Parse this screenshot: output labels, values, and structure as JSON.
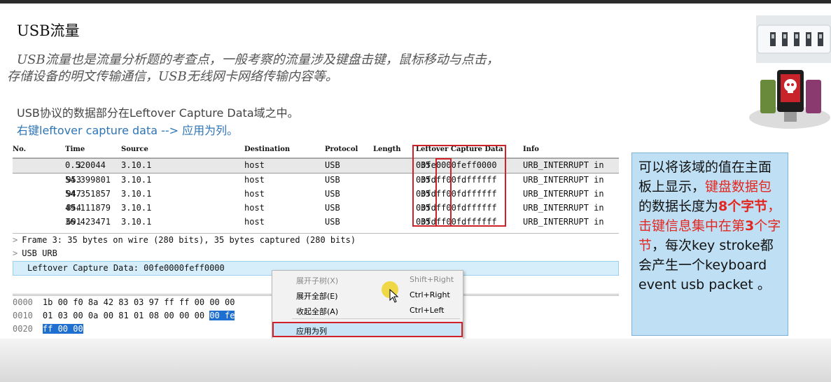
{
  "slide": {
    "title": "USB流量",
    "intro_line1": "USB流量也是流量分析题的考查点，一般考察的流量涉及键盘击键，鼠标移动与点击，",
    "intro_line2": "存储设备的明文传输通信，USB无线网卡网络传输内容等。",
    "note1": "USB协议的数据部分在Leftover Capture Data域之中。",
    "note2": "右键leftover capture data --> 应用为列。"
  },
  "packet_list": {
    "columns": [
      "No.",
      "Time",
      "Source",
      "Destination",
      "Protocol",
      "Length",
      "Leftover Capture Data",
      "Info"
    ],
    "rows": [
      {
        "no": "3",
        "time": "0.520044",
        "src": "3.10.1",
        "dst": "host",
        "proto": "USB",
        "len": "35",
        "data": "00fe0000feff0000",
        "info": "URB_INTERRUPT in"
      },
      {
        "no": "953",
        "time": "54.399801",
        "src": "3.10.1",
        "dst": "host",
        "proto": "USB",
        "len": "35",
        "data": "00fdff00fdffffff",
        "info": "URB_INTERRUPT in"
      },
      {
        "no": "947",
        "time": "54.351857",
        "src": "3.10.1",
        "dst": "host",
        "proto": "USB",
        "len": "35",
        "data": "00fdff00fdffffff",
        "info": "URB_INTERRUPT in"
      },
      {
        "no": "854",
        "time": "49.111879",
        "src": "3.10.1",
        "dst": "host",
        "proto": "USB",
        "len": "35",
        "data": "00fdff00fdffffff",
        "info": "URB_INTERRUPT in"
      },
      {
        "no": "691",
        "time": "36.423471",
        "src": "3.10.1",
        "dst": "host",
        "proto": "USB",
        "len": "35",
        "data": "00fdff00fdffffff",
        "info": "URB_INTERRUPT in"
      }
    ]
  },
  "detail": {
    "frame": "Frame 3: 35 bytes on wire (280 bits), 35 bytes captured (280 bits)",
    "usb_urb": "USB URB",
    "leftover": "Leftover Capture Data: 00fe0000feff0000"
  },
  "hex": [
    {
      "off": "0000",
      "bytes": "1b 00 f0 8a 42 83 03 97  ff ff 00 00 00",
      "hl": ""
    },
    {
      "off": "0010",
      "bytes": "01 03 00 0a 00 81 01 08  00 00 00 ",
      "hl": "00 fe"
    },
    {
      "off": "0020",
      "bytes": "",
      "hl": "ff 00 00"
    }
  ],
  "context_menu": {
    "items": [
      {
        "label": "展开子树(X)",
        "shortcut": "Shift+Right",
        "disabled": true
      },
      {
        "label": "展开全部(E)",
        "shortcut": "Ctrl+Right",
        "disabled": false
      },
      {
        "label": "收起全部(A)",
        "shortcut": "Ctrl+Left",
        "disabled": false
      },
      {
        "label": "应用为列",
        "shortcut": "",
        "disabled": false
      }
    ]
  },
  "callout": {
    "p1": "可以将该域的值在主面板上显示，",
    "p2": "键盘数据包",
    "p3": "的数据长度为",
    "p4": "8个字节",
    "p5": "，",
    "p6": "击键信息集中在第",
    "p7": "3",
    "p8": "个字节",
    "p9": "，每次key stroke都会产生一个keyboard event usb packet 。"
  },
  "colors": {
    "accent_red": "#d0202a",
    "link_blue": "#2e75b6",
    "callout_bg": "#bfe0f4",
    "hex_highlight": "#1f6fd1"
  }
}
